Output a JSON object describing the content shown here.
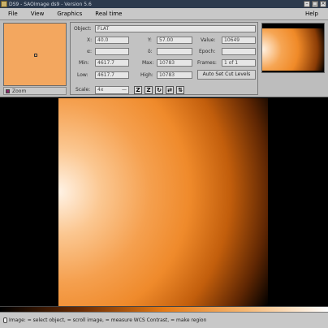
{
  "window": {
    "title": "DS9 - SAOImage ds9 - Version 5.6"
  },
  "menu": {
    "file": "File",
    "view": "View",
    "graphics": "Graphics",
    "realtime": "Real time",
    "help": "Help"
  },
  "zoom_panel": {
    "zoom_label": "Zoom"
  },
  "info": {
    "object_label": "Object:",
    "object_value": "FLAT",
    "x_label": "X:",
    "x_value": "40.0",
    "y_label": "Y:",
    "y_value": "57.00",
    "value_label": "Value:",
    "value_value": "10649",
    "a_label": "α:",
    "a_value": "",
    "d_label": "δ:",
    "d_value": "",
    "epoch_label": "Epoch:",
    "epoch_value": "",
    "min_label": "Min:",
    "min_value": "4617.7",
    "max_label": "Max:",
    "max_value": "10783",
    "frames_label": "Frames:",
    "frames_value": "1 of 1",
    "low_label": "Low:",
    "low_value": "4617.7",
    "high_label": "High:",
    "high_value": "10783",
    "autoset_label": "Auto Set Cut Levels",
    "scale_label": "Scale:",
    "scale_value": "4x"
  },
  "status": {
    "text": "Image:  = select object,  = scroll image,  = measure WCS Contrast,  = make region"
  },
  "colors": {
    "accent": "#f08a28",
    "panel": "#bdbdbd",
    "titlebar": "#2c3a4d"
  }
}
